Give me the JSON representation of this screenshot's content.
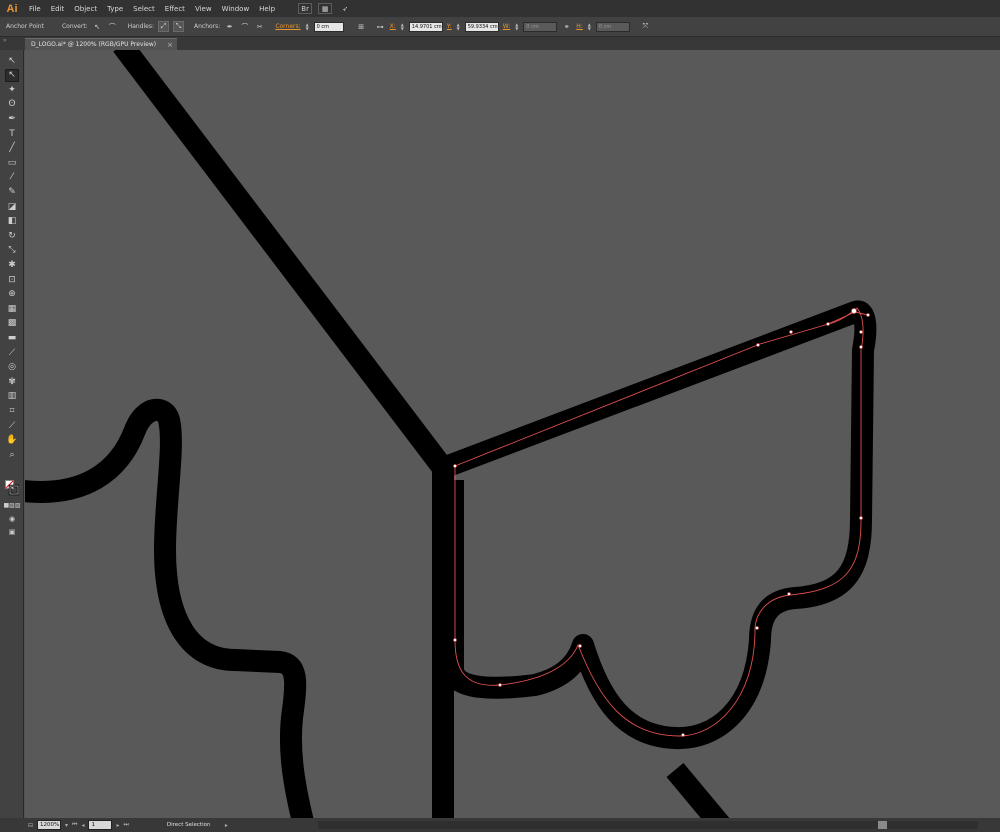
{
  "app": {
    "logo": "Ai",
    "accent": "#e8962e"
  },
  "menu": {
    "items": [
      "File",
      "Edit",
      "Object",
      "Type",
      "Select",
      "Effect",
      "View",
      "Window",
      "Help"
    ]
  },
  "controlbar": {
    "tool_name": "Anchor Point",
    "convert_label": "Convert:",
    "handles_label": "Handles:",
    "anchors_label": "Anchors:",
    "corners_label": "Corners:",
    "corners_value": "0 cm",
    "x_label": "X:",
    "x_value": "14.9701 cm",
    "y_label": "Y:",
    "y_value": "59.9334 cm",
    "w_label": "W:",
    "w_value": "0 cm",
    "h_label": "H:",
    "h_value": "0 cm"
  },
  "document": {
    "tab_title": "D_LOGO.ai* @ 1200% (RGB/GPU Preview)",
    "close_glyph": "×"
  },
  "tools": [
    {
      "name": "selection-tool-icon",
      "glyph": "↖"
    },
    {
      "name": "direct-selection-tool-icon",
      "glyph": "↖"
    },
    {
      "name": "magic-wand-tool-icon",
      "glyph": "✦"
    },
    {
      "name": "lasso-tool-icon",
      "glyph": "ʘ"
    },
    {
      "name": "pen-tool-icon",
      "glyph": "✒"
    },
    {
      "name": "type-tool-icon",
      "glyph": "T"
    },
    {
      "name": "line-tool-icon",
      "glyph": "╱"
    },
    {
      "name": "rectangle-tool-icon",
      "glyph": "▭"
    },
    {
      "name": "paintbrush-tool-icon",
      "glyph": "⁄"
    },
    {
      "name": "pencil-tool-icon",
      "glyph": "✎"
    },
    {
      "name": "blob-brush-tool-icon",
      "glyph": "◪"
    },
    {
      "name": "eraser-tool-icon",
      "glyph": "◧"
    },
    {
      "name": "rotate-tool-icon",
      "glyph": "↻"
    },
    {
      "name": "scale-tool-icon",
      "glyph": "⤡"
    },
    {
      "name": "warp-tool-icon",
      "glyph": "✱"
    },
    {
      "name": "free-transform-tool-icon",
      "glyph": "⊡"
    },
    {
      "name": "shape-builder-tool-icon",
      "glyph": "⊕"
    },
    {
      "name": "perspective-grid-tool-icon",
      "glyph": "▦"
    },
    {
      "name": "mesh-tool-icon",
      "glyph": "▩"
    },
    {
      "name": "gradient-tool-icon",
      "glyph": "▬"
    },
    {
      "name": "eyedropper-tool-icon",
      "glyph": "⟋"
    },
    {
      "name": "blend-tool-icon",
      "glyph": "◎"
    },
    {
      "name": "symbol-sprayer-tool-icon",
      "glyph": "✾"
    },
    {
      "name": "column-graph-tool-icon",
      "glyph": "▥"
    },
    {
      "name": "artboard-tool-icon",
      "glyph": "⌗"
    },
    {
      "name": "slice-tool-icon",
      "glyph": "⟋"
    },
    {
      "name": "hand-tool-icon",
      "glyph": "✋"
    },
    {
      "name": "zoom-tool-icon",
      "glyph": "⌕"
    }
  ],
  "statusbar": {
    "zoom": "1200%",
    "artboard": "1",
    "status_text": "Direct Selection"
  }
}
